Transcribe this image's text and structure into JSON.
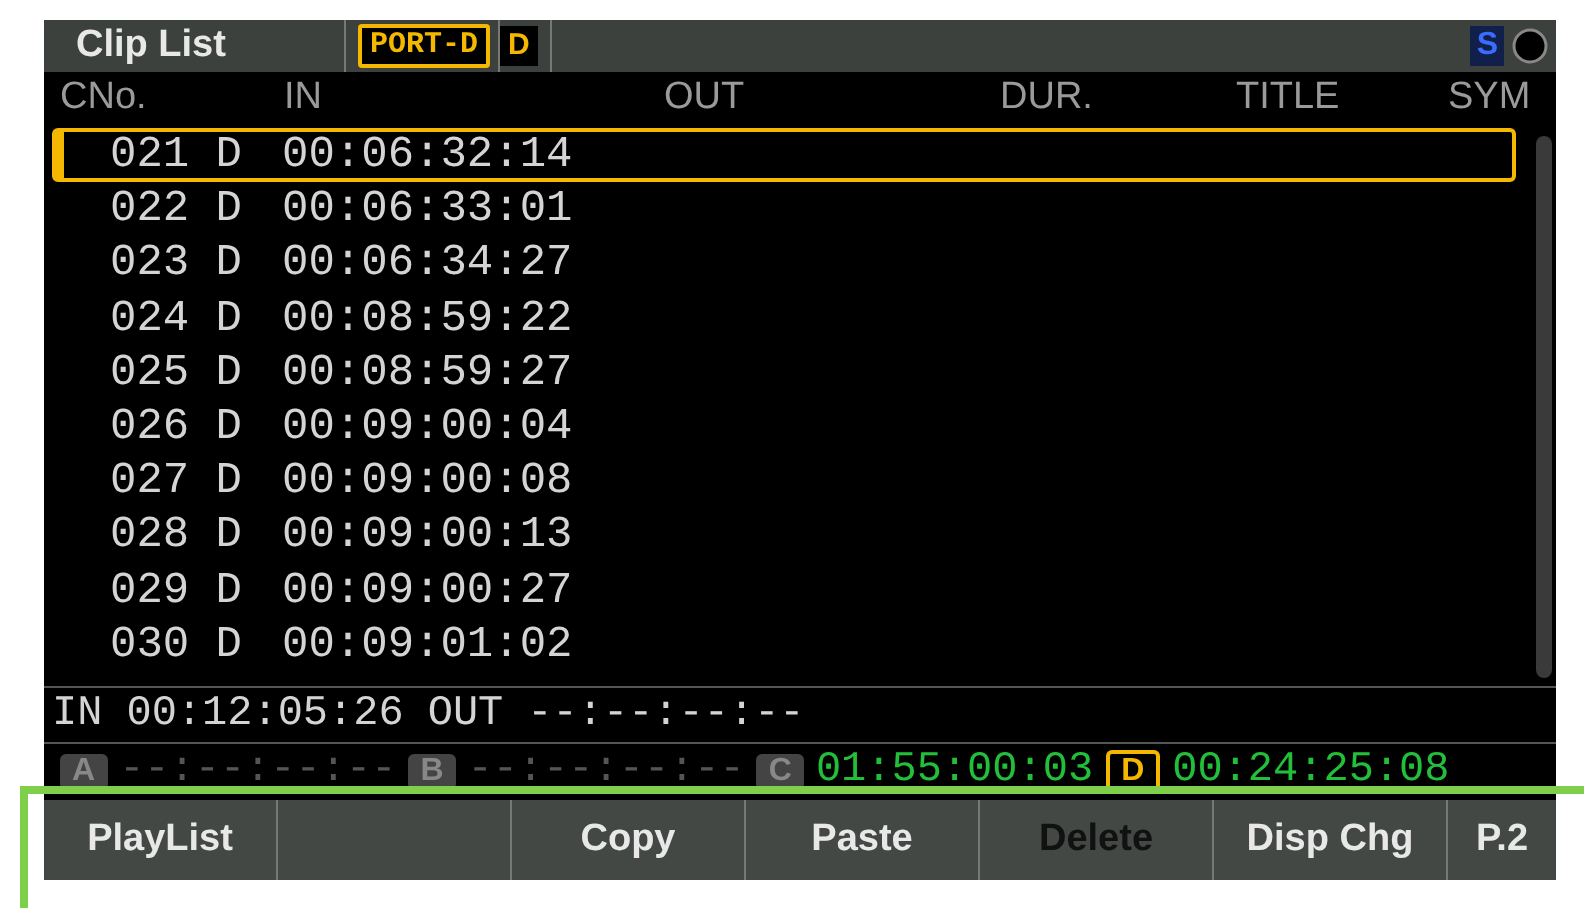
{
  "title_bar": {
    "title": "Clip List",
    "port": "PORT-D",
    "drive": "D",
    "status": "S"
  },
  "columns": [
    "CNo.",
    "IN",
    "OUT",
    "DUR.",
    "TITLE",
    "SYM"
  ],
  "clips": [
    {
      "number": "021",
      "drive": "D",
      "in": "00:06:32:14",
      "selected": true
    },
    {
      "number": "022",
      "drive": "D",
      "in": "00:06:33:01",
      "selected": false
    },
    {
      "number": "023",
      "drive": "D",
      "in": "00:06:34:27",
      "selected": false
    },
    {
      "number": "024",
      "drive": "D",
      "in": "00:08:59:22",
      "selected": false
    },
    {
      "number": "025",
      "drive": "D",
      "in": "00:08:59:27",
      "selected": false
    },
    {
      "number": "026",
      "drive": "D",
      "in": "00:09:00:04",
      "selected": false
    },
    {
      "number": "027",
      "drive": "D",
      "in": "00:09:00:08",
      "selected": false
    },
    {
      "number": "028",
      "drive": "D",
      "in": "00:09:00:13",
      "selected": false
    },
    {
      "number": "029",
      "drive": "D",
      "in": "00:09:00:27",
      "selected": false
    },
    {
      "number": "030",
      "drive": "D",
      "in": "00:09:01:02",
      "selected": false
    }
  ],
  "in_out": {
    "in_label": "IN",
    "in": "00:12:05:26",
    "out_label": "OUT",
    "out": "--:--:--:--"
  },
  "timecodes": [
    {
      "label": "A",
      "value": "--:--:--:--",
      "active": false,
      "selected": false
    },
    {
      "label": "B",
      "value": "--:--:--:--",
      "active": false,
      "selected": false
    },
    {
      "label": "C",
      "value": "01:55:00:03",
      "active": true,
      "selected": false
    },
    {
      "label": "D",
      "value": "00:24:25:08",
      "active": true,
      "selected": true
    }
  ],
  "buttons": [
    {
      "kind": "label",
      "label": "PlayList",
      "disabled": false
    },
    {
      "kind": "blank"
    },
    {
      "kind": "label",
      "label": "Copy",
      "disabled": false
    },
    {
      "kind": "label",
      "label": "Paste",
      "disabled": false
    },
    {
      "kind": "label",
      "label": "Delete",
      "disabled": true
    },
    {
      "kind": "label",
      "label": "Disp Chg",
      "disabled": false
    },
    {
      "kind": "label",
      "label": "P.2",
      "disabled": false
    }
  ]
}
